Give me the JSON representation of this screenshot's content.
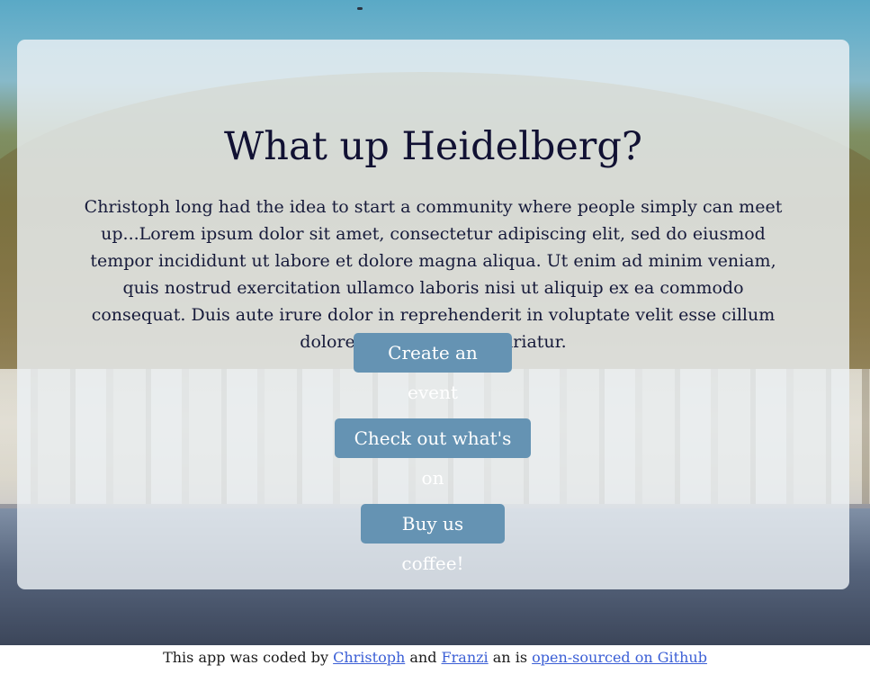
{
  "hero": {
    "title": "What up Heidelberg?",
    "intro": "Christoph long had the idea to start a community where people simply can meet up...Lorem ipsum dolor sit amet, consectetur adipiscing elit, sed do eiusmod tempor incididunt ut labore et dolore magna aliqua. Ut enim ad minim veniam, quis nostrud exercitation ullamco laboris nisi ut aliquip ex ea commodo consequat. Duis aute irure dolor in reprehenderit in voluptate velit esse cillum dolore eu fugiat nulla pariatur."
  },
  "actions": {
    "create_event": "Create an event",
    "check_out": "Check out what's on",
    "buy_coffee": "Buy us coffee!"
  },
  "footer": {
    "prefix": "This app was coded by",
    "author1": "Christoph",
    "and": "and",
    "author2": "Franzi",
    "middle": "an is",
    "repo_link": "open-sourced on Github"
  },
  "colors": {
    "button_bg": "#6593b3",
    "title_color": "#111133",
    "link_color": "#3b5fd6",
    "card_bg": "rgba(236,240,244,0.82)"
  }
}
